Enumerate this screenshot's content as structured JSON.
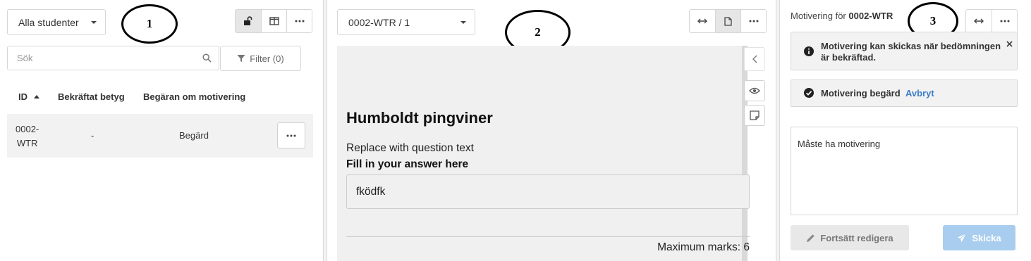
{
  "panel1": {
    "student_filter": "Alla studenter",
    "search_placeholder": "Sök",
    "filter_label": "Filter (0)",
    "columns": [
      "ID",
      "Bekräftat betyg",
      "Begäran om motivering"
    ],
    "rows": [
      {
        "id_line1": "0002-",
        "id_line2": "WTR",
        "grade": "-",
        "request": "Begärd"
      }
    ],
    "annotation": "1"
  },
  "panel2": {
    "page_select": "0002-WTR / 1",
    "annotation": "2",
    "question_title": "Humboldt pingviner",
    "question_text": "Replace with question text",
    "fill_label": "Fill in your answer here",
    "answer": "fködfk",
    "max_marks": "Maximum marks: 6"
  },
  "panel3": {
    "title_prefix": "Motivering för",
    "title_id": "0002-WTR",
    "annotation": "3",
    "info_line1": "Motivering kan skickas när bedömningen",
    "info_line2": "är bekräftad.",
    "requested_label": "Motivering begärd",
    "cancel_label": "Avbryt",
    "motivation_text": "Måste ha motivering",
    "continue_label": "Fortsätt redigera",
    "send_label": "Skicka"
  },
  "colors": {
    "accent": "#3a7dc9",
    "send_disabled": "#a9cdee",
    "row_bg": "#f2f2f2"
  }
}
